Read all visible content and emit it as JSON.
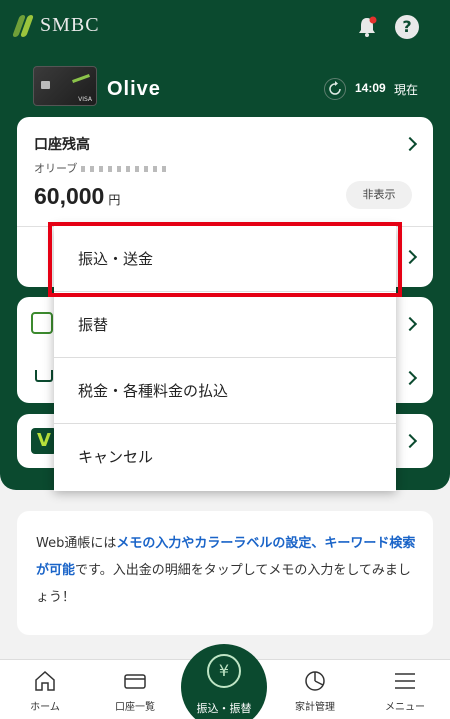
{
  "header": {
    "logo_text": "SMBC",
    "help_label": "?"
  },
  "card": {
    "brand_label": "VISA",
    "name": "Olive",
    "time": "14:09",
    "now_label": "現在"
  },
  "balance": {
    "title": "口座残高",
    "account_prefix": "オリーブ",
    "amount": "60,000",
    "currency": "円",
    "hide_label": "非表示"
  },
  "menu": {
    "items": [
      {
        "label": "振込・送金"
      },
      {
        "label": "振替"
      },
      {
        "label": "税金・各種料金の払込"
      },
      {
        "label": "キャンセル"
      }
    ]
  },
  "info": {
    "parts": [
      {
        "text": "Web通帳には",
        "link": false
      },
      {
        "text": "メモの入力やカラーラベルの設定、キーワード検索が可能",
        "link": true
      },
      {
        "text": "です。入出金の明細をタップしてメモの入力をしてみましょう！",
        "link": false
      }
    ]
  },
  "nav": {
    "home": "ホーム",
    "accounts": "口座一覧",
    "transfer": "振込・振替",
    "household": "家計管理",
    "menu": "メニュー",
    "transfer_icon_text": "¥"
  },
  "colors": {
    "brand_green": "#0b4a2f",
    "highlight_red": "#e50014",
    "link_blue": "#1a64c8"
  }
}
